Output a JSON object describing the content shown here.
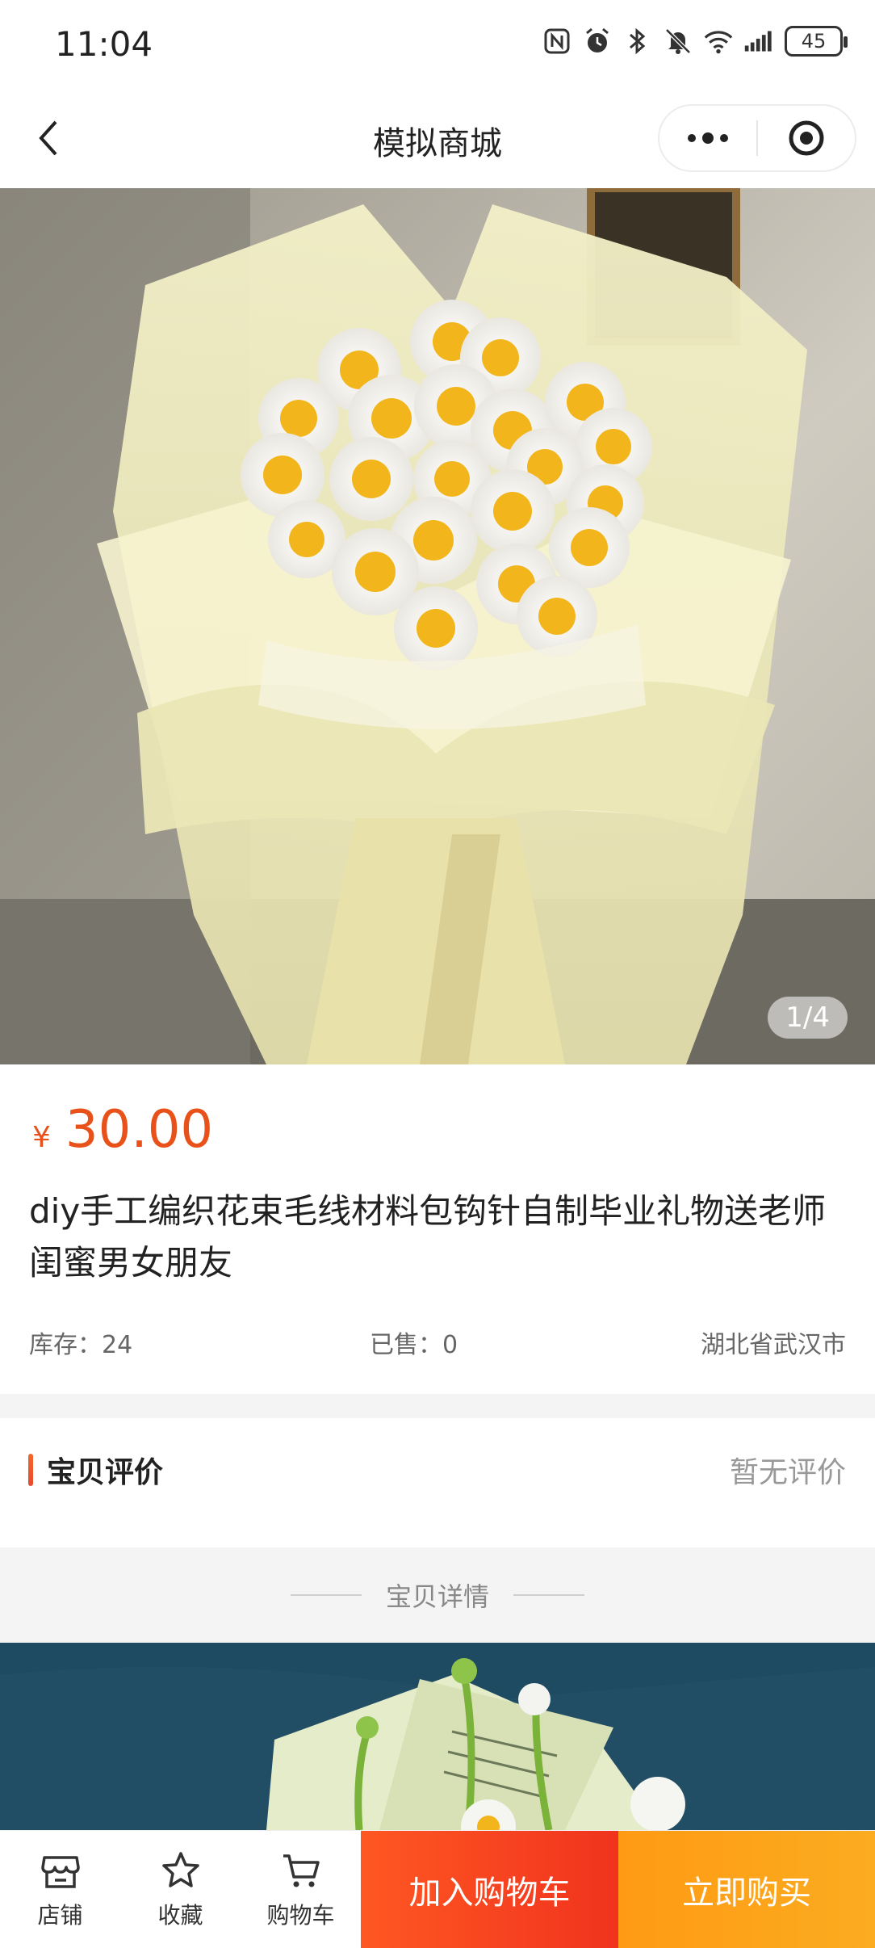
{
  "status_bar": {
    "time": "11:04",
    "battery": "45"
  },
  "nav": {
    "title": "模拟商城"
  },
  "product": {
    "image_counter": "1/4",
    "currency": "¥",
    "price": "30.00",
    "title": "diy手工编织花束毛线材料包钩针自制毕业礼物送老师闺蜜男女朋友",
    "stock": "库存：24",
    "sold": "已售：0",
    "location": "湖北省武汉市"
  },
  "reviews": {
    "title": "宝贝评价",
    "empty": "暂无评价"
  },
  "details": {
    "title": "宝贝详情"
  },
  "bottom_bar": {
    "shop": "店铺",
    "favorite": "收藏",
    "cart": "购物车",
    "add_to_cart": "加入购物车",
    "buy_now": "立即购买"
  },
  "colors": {
    "price": "#e8521a",
    "add_to_cart": "#f0331e",
    "buy_now": "#fba91f"
  }
}
